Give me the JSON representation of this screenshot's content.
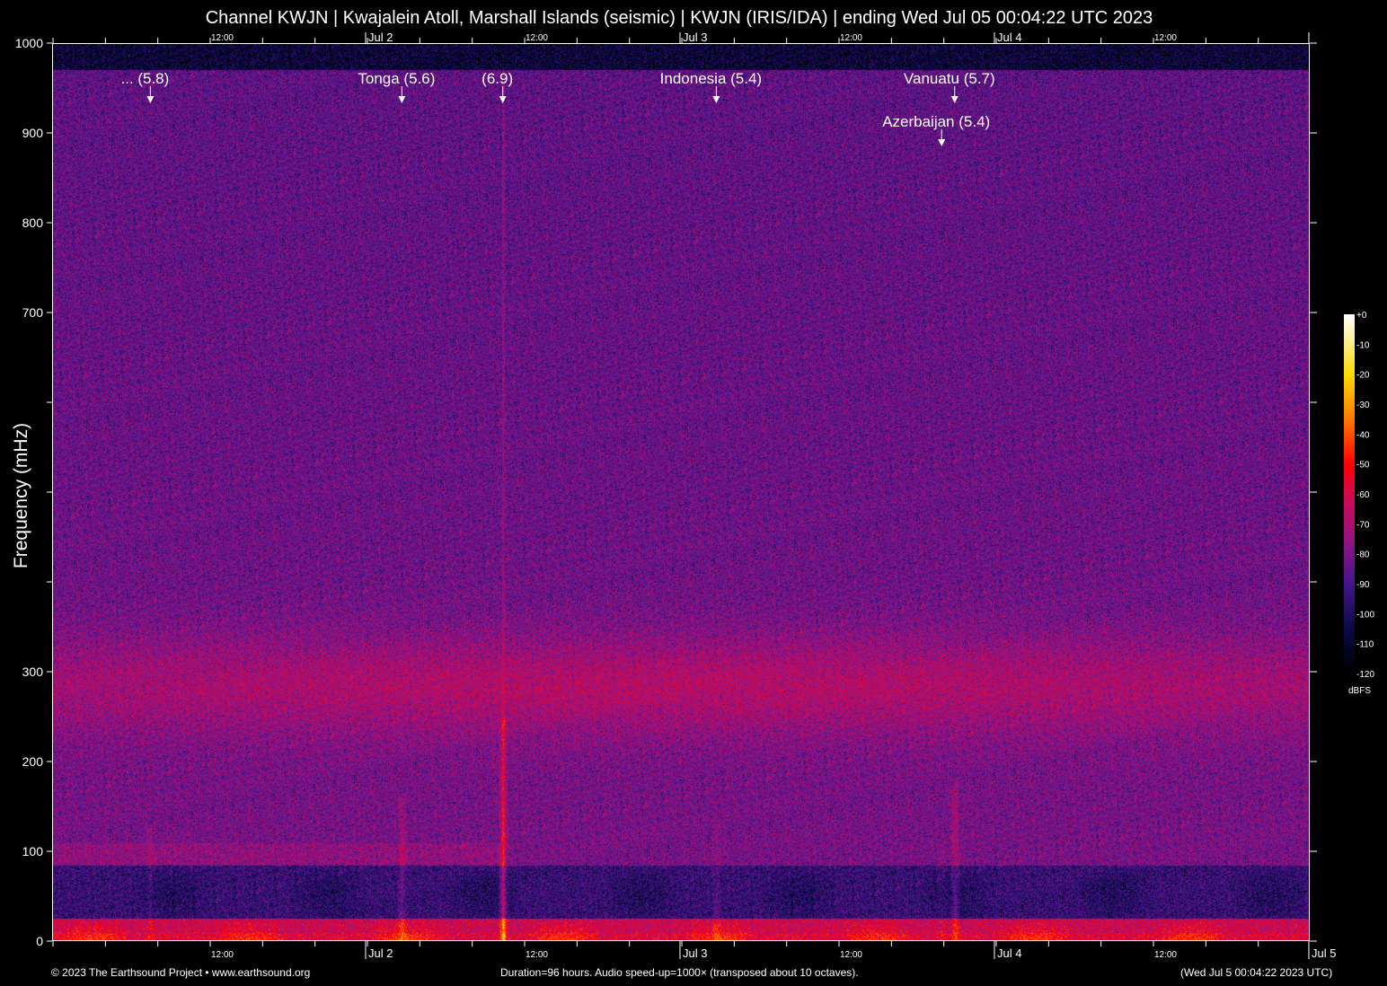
{
  "chart_data": {
    "type": "heatmap",
    "title": "Channel KWJN | Kwajalein Atoll, Marshall Islands (seismic) | KWJN (IRIS/IDA) | ending Wed Jul 05 00:04:22 UTC 2023",
    "ylabel": "Frequency (mHz)",
    "xlabel": "",
    "ylim": [
      0,
      1000
    ],
    "y_tick_labels": [
      {
        "value": 1000,
        "label": "1000"
      },
      {
        "value": 900,
        "label": "900"
      },
      {
        "value": 800,
        "label": "800"
      },
      {
        "value": 700,
        "label": "700"
      },
      {
        "value": 600,
        "label": ""
      },
      {
        "value": 500,
        "label": ""
      },
      {
        "value": 400,
        "label": ""
      },
      {
        "value": 300,
        "label": "300"
      },
      {
        "value": 200,
        "label": "200"
      },
      {
        "value": 100,
        "label": "100"
      },
      {
        "value": 0,
        "label": "0"
      }
    ],
    "x_range_hours": [
      0,
      96
    ],
    "x_tick_interval_hours": 4,
    "x_tick_labels": [
      {
        "hours": 11.93,
        "label": "12:00",
        "kind": "time"
      },
      {
        "hours": 23.93,
        "label": "Jul  2",
        "kind": "day"
      },
      {
        "hours": 35.93,
        "label": "12:00",
        "kind": "time"
      },
      {
        "hours": 47.93,
        "label": "Jul  3",
        "kind": "day"
      },
      {
        "hours": 59.93,
        "label": "12:00",
        "kind": "time"
      },
      {
        "hours": 71.93,
        "label": "Jul  4",
        "kind": "day"
      },
      {
        "hours": 83.93,
        "label": "12:00",
        "kind": "time"
      },
      {
        "hours": 95.93,
        "label": "Jul  5",
        "kind": "day"
      }
    ],
    "events": [
      {
        "label": "... (5.8)",
        "hours": 7.5,
        "row": 1,
        "strength": 0.3
      },
      {
        "label": "Tonga (5.6)",
        "hours": 26.7,
        "row": 1,
        "strength": 0.5
      },
      {
        "label": "(6.9)",
        "hours": 34.4,
        "row": 1,
        "strength": 1.0
      },
      {
        "label": "Indonesia (5.4)",
        "hours": 50.7,
        "row": 1,
        "strength": 0.3
      },
      {
        "label": "Vanuatu (5.7)",
        "hours": 68.9,
        "row": 1,
        "strength": 0.6
      },
      {
        "label": "Azerbaijan (5.4)",
        "hours": 67.9,
        "row": 2,
        "strength": 0.2
      }
    ],
    "colorbar": {
      "label": "dBFS",
      "range": [
        -120,
        0
      ],
      "ticks": [
        "+0",
        "-10",
        "-20",
        "-30",
        "-40",
        "-50",
        "-60",
        "-70",
        "-80",
        "-90",
        "-100",
        "-110",
        "-120"
      ]
    },
    "description_levels_dbfs": {
      "background": -85,
      "microseism_band_250_330mHz": -58,
      "low_freq_notch": -95
    }
  },
  "footer": {
    "copyright": "© 2023 The Earthsound Project • www.earthsound.org",
    "duration": "Duration=96 hours. Audio speed-up=1000× (transposed about 10 octaves).",
    "end_time": "(Wed Jul  5 00:04:22 2023 UTC)"
  }
}
